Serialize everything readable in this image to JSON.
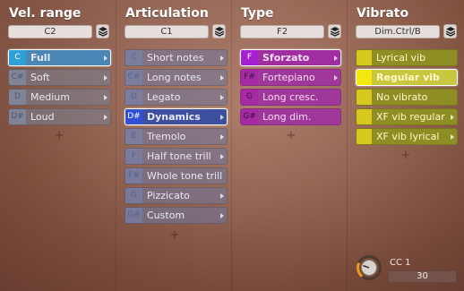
{
  "columns": {
    "velocity": {
      "title": "Vel. range",
      "key": "C2",
      "items": [
        {
          "note": "C",
          "label": "Full"
        },
        {
          "note": "C#",
          "label": "Soft"
        },
        {
          "note": "D",
          "label": "Medium"
        },
        {
          "note": "D#",
          "label": "Loud"
        }
      ],
      "selected": "Full"
    },
    "articulation": {
      "title": "Articulation",
      "key": "C1",
      "items": [
        {
          "note": "C",
          "label": "Short notes"
        },
        {
          "note": "C#",
          "label": "Long notes"
        },
        {
          "note": "D",
          "label": "Legato"
        },
        {
          "note": "D#",
          "label": "Dynamics"
        },
        {
          "note": "E",
          "label": "Tremolo"
        },
        {
          "note": "F",
          "label": "Half tone trill"
        },
        {
          "note": "F#",
          "label": "Whole tone trill"
        },
        {
          "note": "G",
          "label": "Pizzicato"
        },
        {
          "note": "G#",
          "label": "Custom"
        }
      ],
      "selected": "Dynamics"
    },
    "type": {
      "title": "Type",
      "key": "F2",
      "items": [
        {
          "note": "F",
          "label": "Sforzato"
        },
        {
          "note": "F#",
          "label": "Fortepiano"
        },
        {
          "note": "G",
          "label": "Long cresc."
        },
        {
          "note": "G#",
          "label": "Long dim."
        }
      ],
      "selected": "Sforzato"
    },
    "vibrato": {
      "title": "Vibrato",
      "key": "Dim.Ctrl/B",
      "items": [
        {
          "note": "",
          "label": "Lyrical vib"
        },
        {
          "note": "",
          "label": "Regular vib"
        },
        {
          "note": "",
          "label": "No vibrato"
        },
        {
          "note": "",
          "label": "XF vib regular"
        },
        {
          "note": "",
          "label": "XF vib lyrical"
        }
      ],
      "selected": "Regular vib"
    }
  },
  "add_symbol": "+",
  "controller": {
    "label": "CC 1",
    "value": "30",
    "level_fraction": 0.24
  },
  "colors": {
    "velocity_selected": "#2f9fd8",
    "articulation_selected": "#3150d8",
    "type_accent": "#a52aa3",
    "vibrato_accent": "#f3e90e"
  }
}
